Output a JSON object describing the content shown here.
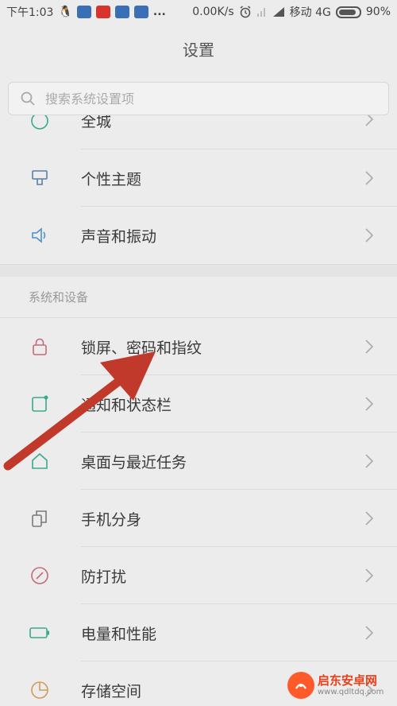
{
  "status_bar": {
    "time": "下午1:03",
    "speed": "0.00K/s",
    "carrier": "移动 4G",
    "battery": "90%",
    "battery_level": 0.9,
    "more": "..."
  },
  "header": {
    "title": "设置"
  },
  "search": {
    "placeholder": "搜索系统设置项"
  },
  "rows_top": [
    {
      "label": "全城",
      "icon": "partial-circle-icon",
      "color": "#3aa98f"
    },
    {
      "label": "个性主题",
      "icon": "theme-brush-icon",
      "color": "#5a7fa8"
    },
    {
      "label": "声音和振动",
      "icon": "speaker-icon",
      "color": "#4f8fc8"
    }
  ],
  "section": {
    "title": "系统和设备"
  },
  "rows_system": [
    {
      "label": "锁屏、密码和指纹",
      "icon": "lock-icon",
      "color": "#c46b7a"
    },
    {
      "label": "通知和状态栏",
      "icon": "notification-icon",
      "color": "#3aa98f"
    },
    {
      "label": "桌面与最近任务",
      "icon": "home-icon",
      "color": "#3aa98f"
    },
    {
      "label": "手机分身",
      "icon": "dual-phone-icon",
      "color": "#7a7a7a"
    },
    {
      "label": "防打扰",
      "icon": "do-not-disturb-icon",
      "color": "#c46b7a"
    },
    {
      "label": "电量和性能",
      "icon": "battery-icon",
      "color": "#3aa98f"
    },
    {
      "label": "存储空间",
      "icon": "pie-storage-icon",
      "color": "#d49a5a"
    }
  ],
  "watermark": {
    "title": "启东安卓网",
    "url": "www.qdltdq.com"
  },
  "colors": {
    "arrow": "#c0392b",
    "background": "#ececec"
  }
}
